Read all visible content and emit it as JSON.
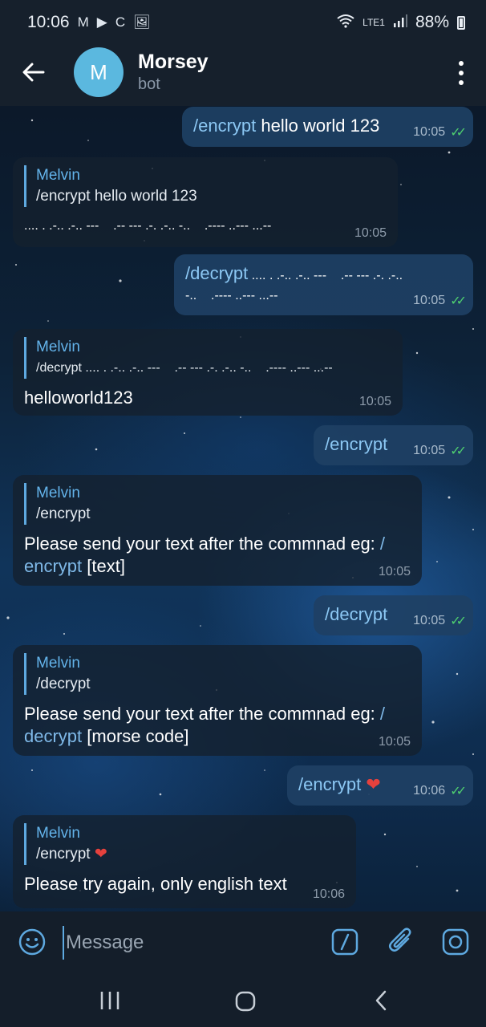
{
  "status_bar": {
    "time": "10:06",
    "left_icons": [
      "M",
      "▶",
      "C",
      "🖼"
    ],
    "network": "LTE1",
    "battery": "88%"
  },
  "header": {
    "avatar_letter": "M",
    "title": "Morsey",
    "subtitle": "bot"
  },
  "messages": {
    "m1": {
      "cmd": "/encrypt",
      "text": " hello world 123",
      "time": "10:05"
    },
    "m2": {
      "reply_name": "Melvin",
      "reply_text": "/encrypt hello world 123",
      "text": ".... . .-.. .-.. ---    .-- --- .-. .-.. -..    .---- ..--- ...--",
      "time": "10:05"
    },
    "m3": {
      "cmd": "/decrypt",
      "text1": " .... . .-.. .-.. ---    .-- --- .-. .-..",
      "text2": "-..    .---- ..--- ...--",
      "time": "10:05"
    },
    "m4": {
      "reply_name": "Melvin",
      "reply_text": "/decrypt .... . .-.. .-.. ---    .-- --- .-. .-.. -..    .---- ..--- ...--",
      "text": "helloworld123",
      "time": "10:05"
    },
    "m5": {
      "cmd": "/encrypt",
      "time": "10:05"
    },
    "m6": {
      "reply_name": "Melvin",
      "reply_text": "/encrypt",
      "text": "Please send your text after the commnad eg: ",
      "link1": "/",
      "link2": "encrypt",
      "text2": " [text]",
      "time": "10:05"
    },
    "m7": {
      "cmd": "/decrypt",
      "time": "10:05"
    },
    "m8": {
      "reply_name": "Melvin",
      "reply_text": "/decrypt",
      "text": "Please send your text after the commnad eg: ",
      "link1": "/",
      "link2": "decrypt",
      "text2": " [morse code]",
      "time": "10:05"
    },
    "m9": {
      "cmd": "/encrypt",
      "heart": "❤",
      "time": "10:06"
    },
    "m10": {
      "reply_name": "Melvin",
      "reply_text": "/encrypt",
      "heart": "❤",
      "text": "Please try again, only english text",
      "time": "10:06"
    }
  },
  "composer": {
    "placeholder": "Message"
  },
  "colors": {
    "accent": "#5ea9e0",
    "check": "#4fcf6f",
    "header_bg": "#16202c"
  }
}
